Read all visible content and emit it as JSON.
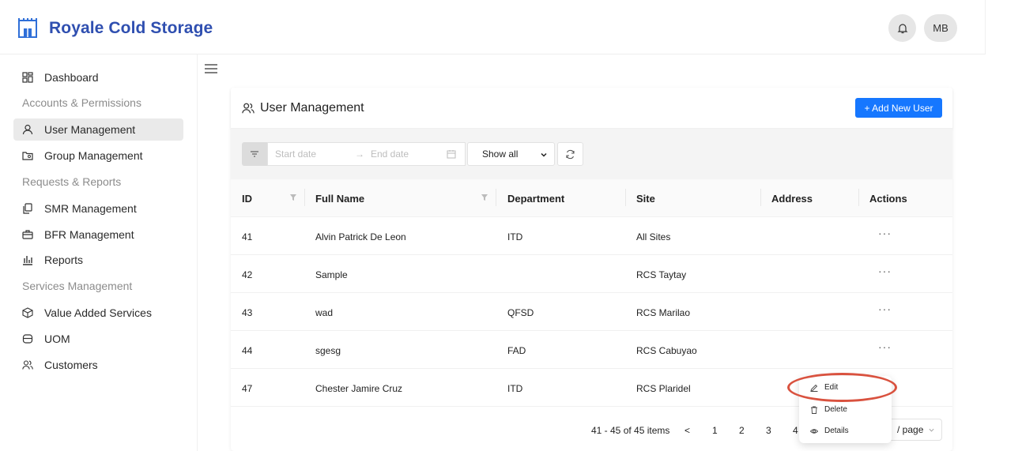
{
  "header": {
    "app_title": "Royale Cold Storage",
    "avatar_initials": "MB"
  },
  "sidebar": {
    "dashboard": "Dashboard",
    "group_accounts": "Accounts & Permissions",
    "user_management": "User Management",
    "group_management": "Group Management",
    "group_requests": "Requests & Reports",
    "smr_management": "SMR Management",
    "bfr_management": "BFR Management",
    "reports": "Reports",
    "group_services": "Services Management",
    "value_added_services": "Value Added Services",
    "uom": "UOM",
    "customers": "Customers"
  },
  "card": {
    "title": "User Management",
    "add_button": "+ Add New User"
  },
  "filters": {
    "start_placeholder": "Start date",
    "arrow": "→",
    "end_placeholder": "End date",
    "select_value": "Show all"
  },
  "table": {
    "columns": {
      "id": "ID",
      "full_name": "Full Name",
      "department": "Department",
      "site": "Site",
      "address": "Address",
      "actions": "Actions"
    },
    "rows": [
      {
        "id": "41",
        "name": "Alvin Patrick De Leon",
        "dept": "ITD",
        "site": "All Sites",
        "actions": "···"
      },
      {
        "id": "42",
        "name": "Sample",
        "dept": "",
        "site": "RCS Taytay",
        "actions": "···"
      },
      {
        "id": "43",
        "name": "wad",
        "dept": "QFSD",
        "site": "RCS Marilao",
        "actions": "···"
      },
      {
        "id": "44",
        "name": "sgesg",
        "dept": "FAD",
        "site": "RCS Cabuyao",
        "actions": "···"
      },
      {
        "id": "47",
        "name": "Chester Jamire Cruz",
        "dept": "ITD",
        "site": "RCS Plaridel",
        "actions": ""
      }
    ]
  },
  "pagination": {
    "range": "41 - 45 of 45 items",
    "prev": "<",
    "pages": [
      "1",
      "2",
      "3",
      "4"
    ],
    "page_size": "/ page"
  },
  "dropdown": {
    "edit": "Edit",
    "delete": "Delete",
    "details": "Details"
  },
  "colors": {
    "accent": "#1677ff",
    "brand": "#2f4fb0",
    "highlight": "#d9523f"
  }
}
